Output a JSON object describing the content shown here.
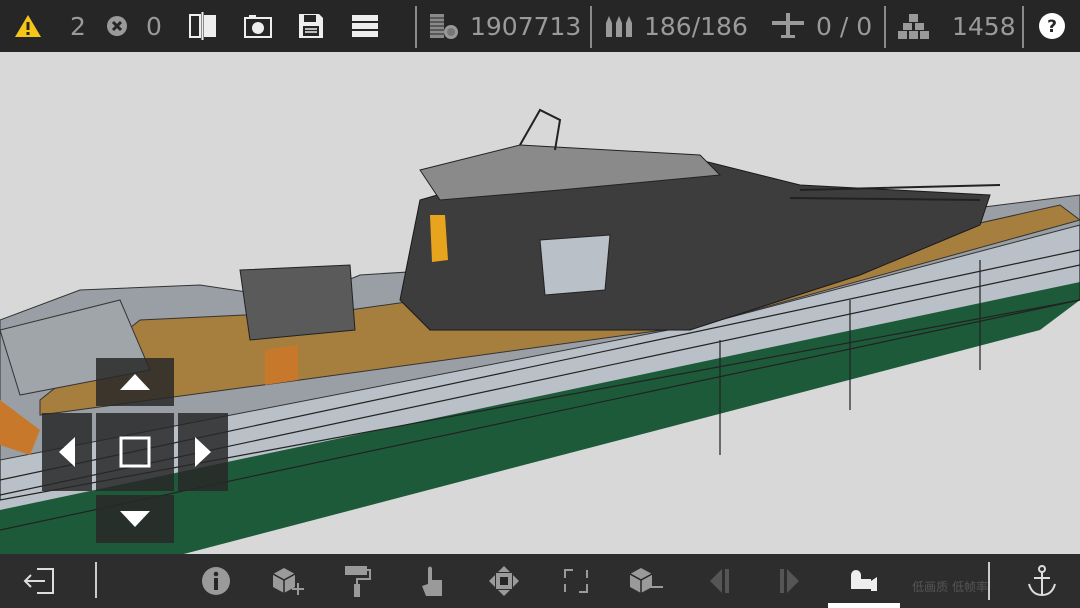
{
  "topbar": {
    "warnings": "2",
    "errors": "0",
    "cost": "1907713",
    "ammo": "186/186",
    "aircraft": "0 / 0",
    "blocks": "1458"
  },
  "bottombar": {
    "watermark": "低画质 低帧率"
  },
  "colors": {
    "warning": "#f5c518",
    "bar": "#262626",
    "hull": "#b9c0c7",
    "green": "#1d5a3a",
    "deck": "#a67f3f",
    "superstructure": "#3d3d3d"
  }
}
